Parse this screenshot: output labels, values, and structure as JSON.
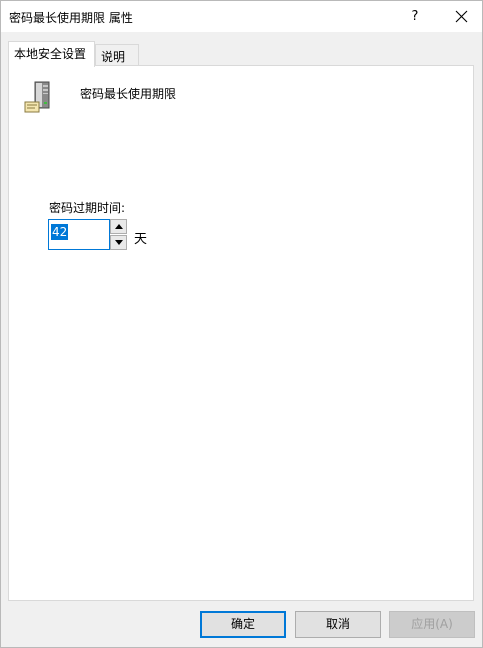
{
  "window": {
    "title": "密码最长使用期限 属性",
    "help": "?",
    "close_icon": "close-icon"
  },
  "tabs": [
    {
      "label": "本地安全设置",
      "active": true
    },
    {
      "label": "说明",
      "active": false
    }
  ],
  "policy": {
    "icon": "server-computer-icon",
    "name": "密码最长使用期限"
  },
  "expiry": {
    "label": "密码过期时间:",
    "value": "42",
    "unit": "天"
  },
  "buttons": {
    "ok": "确定",
    "cancel": "取消",
    "apply": "应用(A)"
  },
  "colors": {
    "accent": "#0078d7",
    "dialog_bg": "#f0f0f0",
    "disabled_text": "#a0a0a0"
  }
}
